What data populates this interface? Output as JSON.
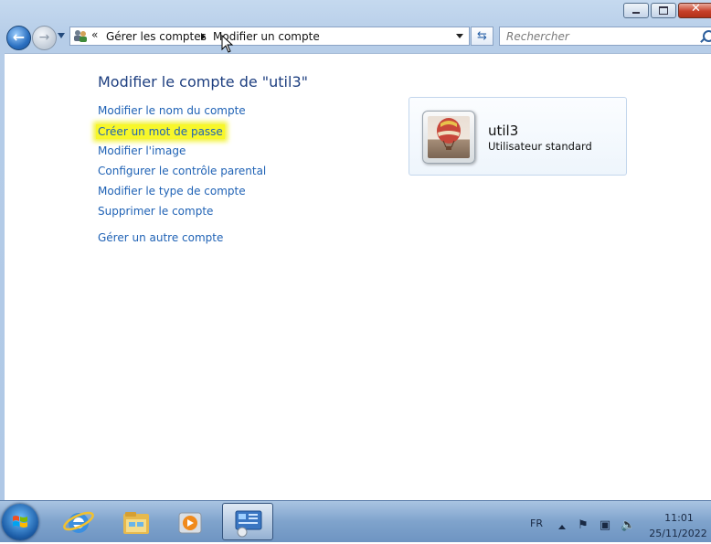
{
  "address_bar": {
    "breadcrumbs": [
      "Gérer les comptes",
      "Modifier un compte"
    ],
    "overflow_chevron": "«"
  },
  "search": {
    "placeholder": "Rechercher"
  },
  "page": {
    "title": "Modifier le compte de \"util3\"",
    "tasks": [
      "Modifier le nom du compte",
      "Créer un mot de passe",
      "Modifier l'image",
      "Configurer le contrôle parental",
      "Modifier le type de compte",
      "Supprimer le compte"
    ],
    "other_task": "Gérer un autre compte",
    "highlighted_task_color": "#f7f72a"
  },
  "account": {
    "name": "util3",
    "type": "Utilisateur standard",
    "picture": "hot-air-balloon"
  },
  "taskbar": {
    "pinned": [
      "start-orb",
      "internet-explorer-icon",
      "windows-explorer-icon",
      "media-player-icon",
      "control-panel-icon"
    ],
    "active": "control-panel-icon",
    "language": "FR",
    "time": "11:01",
    "date": "25/11/2022"
  },
  "colors": {
    "link": "#1f62b5",
    "title": "#1e3f80"
  }
}
